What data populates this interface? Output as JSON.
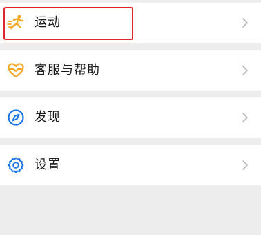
{
  "menu": {
    "items": [
      {
        "label": "运动",
        "icon": "running-person-icon",
        "icon_color": "#f5a623",
        "highlighted": true
      },
      {
        "label": "客服与帮助",
        "icon": "heart-handshake-icon",
        "icon_color": "#f5a623"
      },
      {
        "label": "发现",
        "icon": "compass-icon",
        "icon_color": "#1a73e8"
      },
      {
        "label": "设置",
        "icon": "gear-icon",
        "icon_color": "#1a73e8"
      }
    ]
  },
  "colors": {
    "background": "#ededed",
    "row": "#ffffff",
    "highlight_border": "#e0262b",
    "chevron": "#b8b8b8"
  }
}
